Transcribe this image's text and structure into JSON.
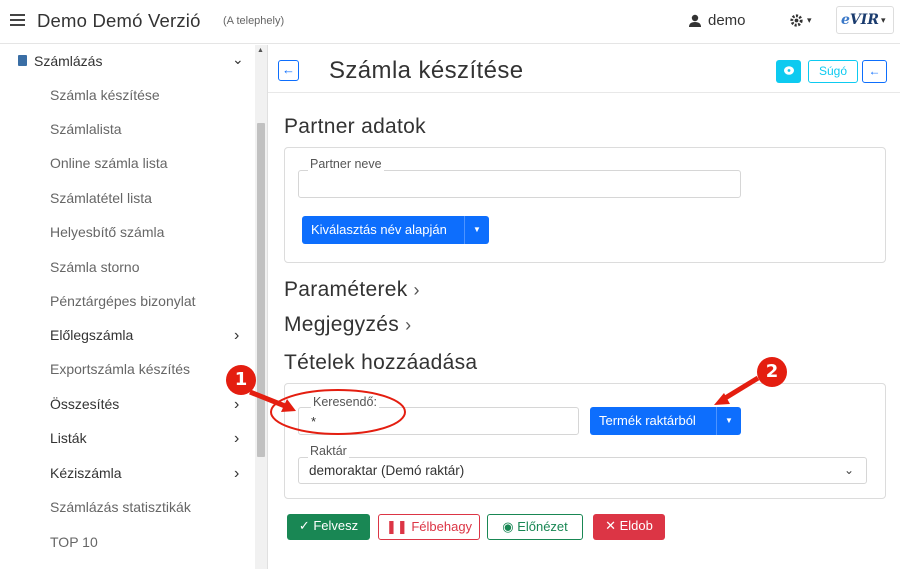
{
  "header": {
    "app_title": "Demo Demó Verzió",
    "app_subtitle": "(A telephely)",
    "user_name": "demo",
    "logo_text_a": "e",
    "logo_text_b": "VIR",
    "caret": "▾"
  },
  "sidebar": {
    "section_label": "Számlázás",
    "section_chevron": "⌄",
    "items": [
      {
        "label": "Számla készítése"
      },
      {
        "label": "Számlalista"
      },
      {
        "label": "Online számla lista"
      },
      {
        "label": "Számlatétel lista"
      },
      {
        "label": "Helyesbítő számla"
      },
      {
        "label": "Számla storno"
      },
      {
        "label": "Pénztárgépes bizonylat"
      },
      {
        "label": "Előlegszámla",
        "arrow": "›"
      },
      {
        "label": "Exportszámla készítés"
      },
      {
        "label": "Összesítés",
        "arrow": "›"
      },
      {
        "label": "Listák",
        "arrow": "›"
      },
      {
        "label": "Kéziszámla",
        "arrow": "›"
      },
      {
        "label": "Számlázás statisztikák"
      },
      {
        "label": "TOP 10"
      }
    ]
  },
  "main": {
    "back_glyph": "←",
    "page_title": "Számla készítése",
    "help_label": "Súgó",
    "partner_section": "Partner adatok",
    "partner_name_label": "Partner neve",
    "partner_name_value": "",
    "select_by_name_btn": "Kiválasztás név alapján",
    "params_section": "Paraméterek",
    "notes_section": "Megjegyzés",
    "section_arrow": "›",
    "items_section": "Tételek hozzáadása",
    "search_label": "Keresendő:",
    "search_value": "*",
    "warehouse_btn": "Termék raktárból",
    "warehouse_label": "Raktár",
    "warehouse_value": "demoraktar (Demó raktár)",
    "dropdown_glyph": "⌄"
  },
  "actions": {
    "add": "Felvesz",
    "abort": "Félbehagy",
    "preview": "Előnézet",
    "discard": "Eldob"
  },
  "annotations": {
    "badge_1": "1",
    "badge_2": "2",
    "color": "#e41e10"
  }
}
